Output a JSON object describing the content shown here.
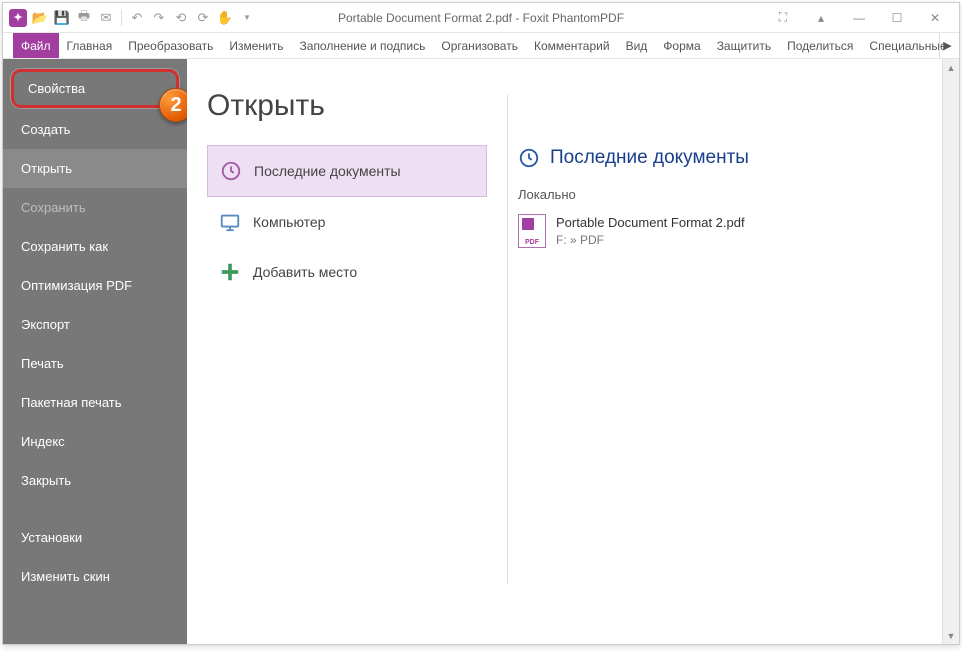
{
  "titlebar": {
    "title": "Portable Document Format 2.pdf - Foxit PhantomPDF"
  },
  "ribbon": {
    "tabs": [
      "Файл",
      "Главная",
      "Преобразовать",
      "Изменить",
      "Заполнение и подпись",
      "Организовать",
      "Комментарий",
      "Вид",
      "Форма",
      "Защитить",
      "Поделиться",
      "Специальные"
    ]
  },
  "sidebar": {
    "highlight": {
      "label": "Свойства",
      "badge": "2"
    },
    "items": [
      {
        "label": "Создать"
      },
      {
        "label": "Открыть",
        "selected": true
      },
      {
        "label": "Сохранить",
        "disabled": true
      },
      {
        "label": "Сохранить как"
      },
      {
        "label": "Оптимизация PDF"
      },
      {
        "label": "Экспорт"
      },
      {
        "label": "Печать"
      },
      {
        "label": "Пакетная печать"
      },
      {
        "label": "Индекс"
      },
      {
        "label": "Закрыть"
      }
    ],
    "bottom": [
      {
        "label": "Установки"
      },
      {
        "label": "Изменить скин"
      }
    ]
  },
  "main": {
    "title": "Открыть",
    "options": {
      "recent": "Последние документы",
      "computer": "Компьютер",
      "addplace": "Добавить место"
    },
    "right": {
      "header": "Последние документы",
      "group": "Локально",
      "file": {
        "name": "Portable Document Format 2.pdf",
        "path": "F: » PDF"
      }
    }
  }
}
